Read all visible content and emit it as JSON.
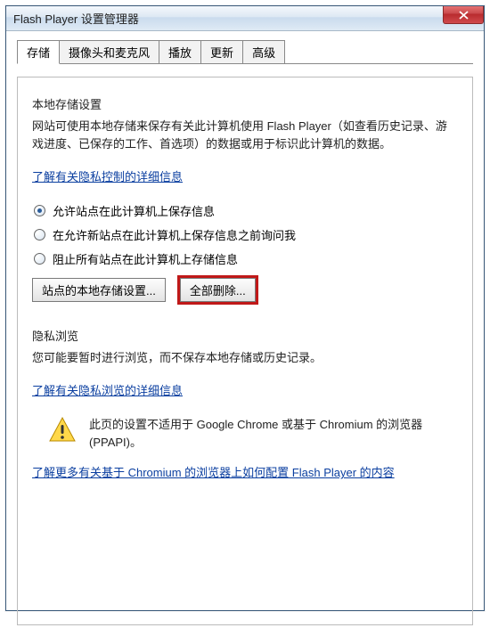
{
  "window": {
    "title": "Flash Player 设置管理器"
  },
  "tabs": {
    "items": [
      {
        "label": "存储",
        "active": true
      },
      {
        "label": "摄像头和麦克风",
        "active": false
      },
      {
        "label": "播放",
        "active": false
      },
      {
        "label": "更新",
        "active": false
      },
      {
        "label": "高级",
        "active": false
      }
    ]
  },
  "storage": {
    "heading": "本地存储设置",
    "description": "网站可使用本地存储来保存有关此计算机使用 Flash Player（如查看历史记录、游戏进度、已保存的工作、首选项）的数据或用于标识此计算机的数据。",
    "learn_privacy_link": "了解有关隐私控制的详细信息",
    "radio": {
      "allow": "允许站点在此计算机上保存信息",
      "ask": "在允许新站点在此计算机上保存信息之前询问我",
      "block": "阻止所有站点在此计算机上存储信息",
      "selected": "allow"
    },
    "btn_site_settings": "站点的本地存储设置...",
    "btn_delete_all": "全部删除..."
  },
  "private": {
    "heading": "隐私浏览",
    "description": "您可能要暂时进行浏览，而不保存本地存储或历史记录。",
    "learn_link": "了解有关隐私浏览的详细信息"
  },
  "warning": {
    "text": "此页的设置不适用于 Google Chrome 或基于 Chromium 的浏览器 (PPAPI)。"
  },
  "chromium_link": "了解更多有关基于 Chromium 的浏览器上如何配置 Flash Player 的内容"
}
